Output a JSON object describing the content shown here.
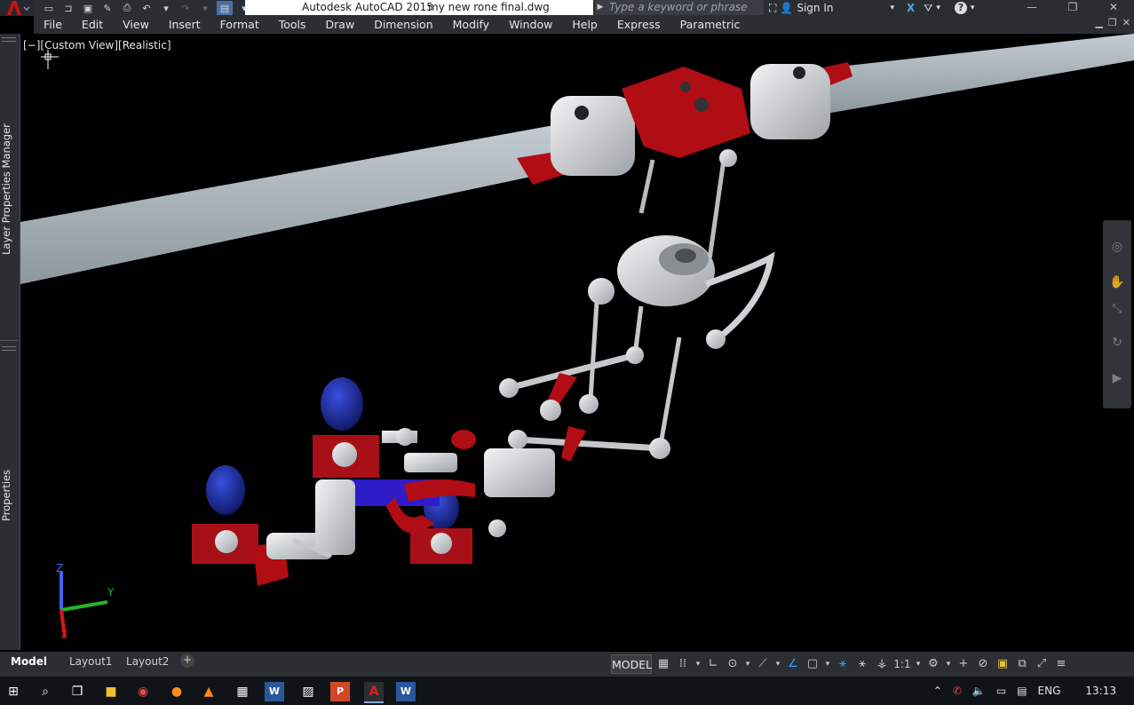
{
  "window": {
    "app_title": "Autodesk AutoCAD 2015",
    "file_title": "my new rone final.dwg",
    "search_placeholder": "Type a keyword or phrase",
    "sign_in": "Sign In"
  },
  "menu": [
    "File",
    "Edit",
    "View",
    "Insert",
    "Format",
    "Tools",
    "Draw",
    "Dimension",
    "Modify",
    "Window",
    "Help",
    "Express",
    "Parametric"
  ],
  "viewport": {
    "label": "[−][Custom View][Realistic]"
  },
  "palettes": {
    "layer_properties": "Layer Properties Manager",
    "properties": "Properties"
  },
  "ucs": {
    "x": "X",
    "y": "Y",
    "z": "Z"
  },
  "layout_tabs": [
    "Model",
    "Layout1",
    "Layout2"
  ],
  "status": {
    "model": "MODEL",
    "scale": "1:1"
  },
  "tray": {
    "language": "ENG",
    "time": "13:13"
  },
  "colors": {
    "accent_red": "#b31b1b",
    "blade": "#a9b3ba",
    "part_red": "#b10d14",
    "motor_blue": "#1a2a9c",
    "metal": "#d6d8da"
  }
}
